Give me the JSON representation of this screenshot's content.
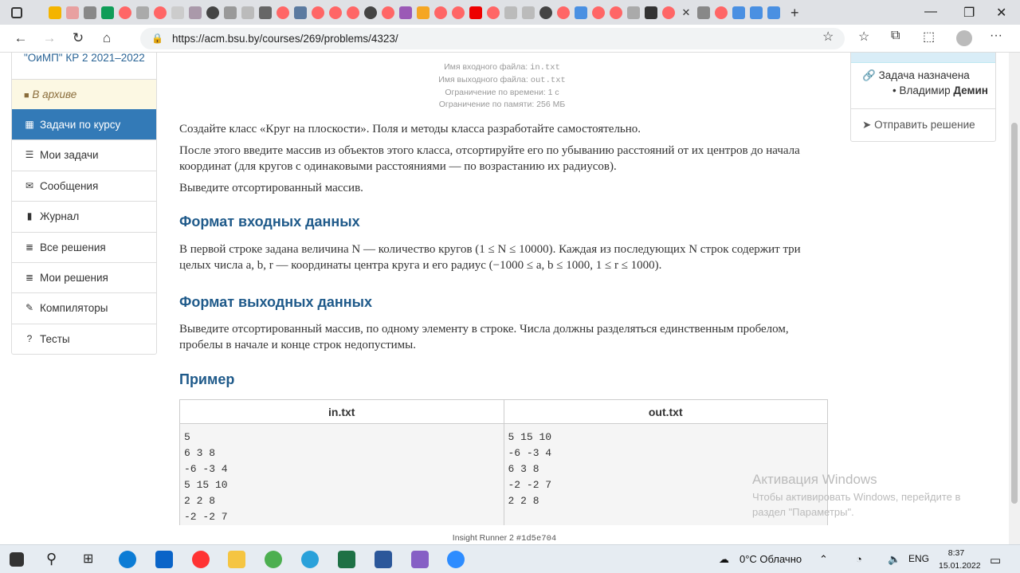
{
  "browser": {
    "url": "https://acm.bsu.by/courses/269/problems/4323/"
  },
  "sidebar": {
    "course": "\"ОиМП\" КР 2 2021–2022",
    "archived": "В архиве",
    "items": [
      {
        "label": "Задачи по курсу",
        "icon": "grid-icon",
        "active": true
      },
      {
        "label": "Мои задачи",
        "icon": "list-icon"
      },
      {
        "label": "Сообщения",
        "icon": "envelope-icon"
      },
      {
        "label": "Журнал",
        "icon": "book-icon"
      },
      {
        "label": "Все решения",
        "icon": "list-alt-icon"
      },
      {
        "label": "Мои решения",
        "icon": "list-alt-icon"
      },
      {
        "label": "Компиляторы",
        "icon": "pushpin-icon"
      },
      {
        "label": "Тесты",
        "icon": "question-icon"
      }
    ]
  },
  "meta": {
    "input_label": "Имя входного файла:",
    "input_file": "in.txt",
    "output_label": "Имя выходного файла:",
    "output_file": "out.txt",
    "time": "Ограничение по времени: 1 с",
    "memory": "Ограничение по памяти: 256 МБ"
  },
  "statement": {
    "p1": "Создайте класс «Круг на плоскости». Поля и методы класса разработайте самостоятельно.",
    "p2": "После этого введите массив из объектов этого класса, отсортируйте его по убыванию расстояний от их центров до начала координат (для кругов с одинаковыми расстояниями — по возрастанию их радиусов).",
    "p3": "Выведите отсортированный массив.",
    "input_title": "Формат входных данных",
    "input_text": "В первой строке задана величина N — количество кругов (1 ≤ N ≤ 10000). Каждая из последующих N строк содержит три целых числа a, b, r — координаты центра круга и его радиус (−1000 ≤ a, b ≤ 1000, 1 ≤ r ≤ 1000).",
    "output_title": "Формат выходных данных",
    "output_text": "Выведите отсортированный массив, по одному элементу в строке. Числа должны разделяться единственным пробелом, пробелы в начале и конце строк недопустимы.",
    "example_title": "Пример"
  },
  "example": {
    "col_in": "in.txt",
    "col_out": "out.txt",
    "input": "5\n6 3 8\n-6 -3 4\n5 15 10\n2 2 8\n-2 -2 7",
    "output": "5 15 10\n-6 -3 4\n6 3 8\n-2 -2 7\n2 2 8"
  },
  "right_panel": {
    "assigned": "Задача назначена",
    "user_first": "Владимир",
    "user_last": "Демин",
    "submit": "Отправить решение"
  },
  "footer": {
    "text": "Insight Runner 2",
    "hash": "#1d5e704"
  },
  "watermark": {
    "title": "Активация Windows",
    "line1": "Чтобы активировать Windows, перейдите в",
    "line2": "раздел \"Параметры\"."
  },
  "taskbar": {
    "weather": "0°C  Облачно",
    "lang": "ENG",
    "time": "8:37",
    "date": "15.01.2022"
  }
}
